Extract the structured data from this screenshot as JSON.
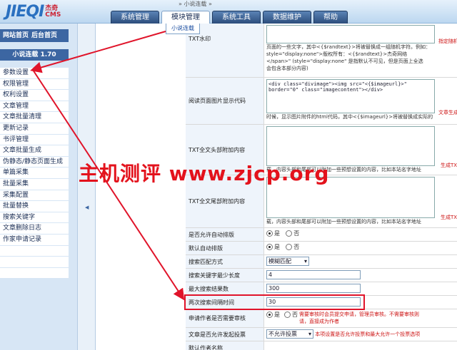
{
  "header": {
    "logo_main": "JIEQI",
    "logo_sup": "杰奇",
    "logo_sub": "CMS",
    "breadcrumb": "» 小说连载 »",
    "tabs": [
      {
        "label": "系统管理",
        "active": false
      },
      {
        "label": "模块管理",
        "active": true
      },
      {
        "label": "系统工具",
        "active": false
      },
      {
        "label": "数据维护",
        "active": false
      },
      {
        "label": "帮助",
        "active": false
      }
    ],
    "submenu_item": "小说连载"
  },
  "sidebar": {
    "site_home": "网站首页",
    "admin_home": "后台首页",
    "module_title": "小说连载 1.70",
    "items": [
      "参数设置",
      "权限管理",
      "权利设置",
      "文章管理",
      "文章批量清理",
      "更新记录",
      "书评管理",
      "文章批量生成",
      "伪静态/静态页面生成",
      "单篇采集",
      "批量采集",
      "采集配置",
      "批量替换",
      "搜索关键字",
      "文章删除日志",
      "作家申请记录",
      "",
      "",
      ""
    ]
  },
  "form": {
    "watermark_label": "TXT水印",
    "watermark_note": "指定随机",
    "watermark_desc1": "页面的一些文字，其中<{$randtext}>将被替换成一组随机字符。例如：",
    "watermark_desc2": "style=\"display:none\">版权所有：<{$randtext}>杰奇网络",
    "watermark_desc3": "</span>\" (style=\"display:none\" 是指默认不可见，但是页面上全选",
    "watermark_desc4": "会包含本部分内容)",
    "img_label": "阅读页面图片显示代码",
    "img_code": "<div class=\"divimage\"><img src=\"<{$imageurl}>\" border=\"0\" class=\"imagecontent\"></div>",
    "img_note": "文章生成",
    "img_desc": "时候，显示图片附件的html代码，其中<{$imageurl}>将被替换成实际的",
    "head_label": "TXT全文头部附加内容",
    "head_note": "生成TXT",
    "head_desc": "载，内容头部和尾部可以附加一些预想设置的内容，比如本站名字地址",
    "tail_label": "TXT全文尾部附加内容",
    "tail_note": "生成TXT",
    "tail_desc": "载，内容头部和尾部可以附加一些预想设置的内容，比如本站名字地址",
    "autoreview_label": "是否允许自动排版",
    "yes": "是",
    "no": "否",
    "default_layout_label": "默认自动排版",
    "search_mode_label": "搜索匹配方式",
    "search_mode_value": "模糊匹配",
    "min_kw_label": "搜索关键字最少长度",
    "min_kw_value": "4",
    "max_results_label": "最大搜索结果数",
    "max_results_value": "300",
    "interval_label": "两次搜索间隔时间",
    "interval_value": "30",
    "author_label": "申请作者是否需要审核",
    "author_hint1": "需要审核时会员提交申请，管理员审核。不需要审核则",
    "author_hint2": "请，直接成为作者",
    "vote_label": "文章是否允许发起投票",
    "vote_value": "不允许投票",
    "vote_hint": "本项设置是否允许投票和最大允许一个投票选项",
    "last_label": "默认作者名称"
  },
  "overlay": {
    "watermark_text": "主机测评 www.zjcp.org"
  },
  "colors": {
    "accent": "#3c66a2",
    "annotation": "#e0142a"
  }
}
